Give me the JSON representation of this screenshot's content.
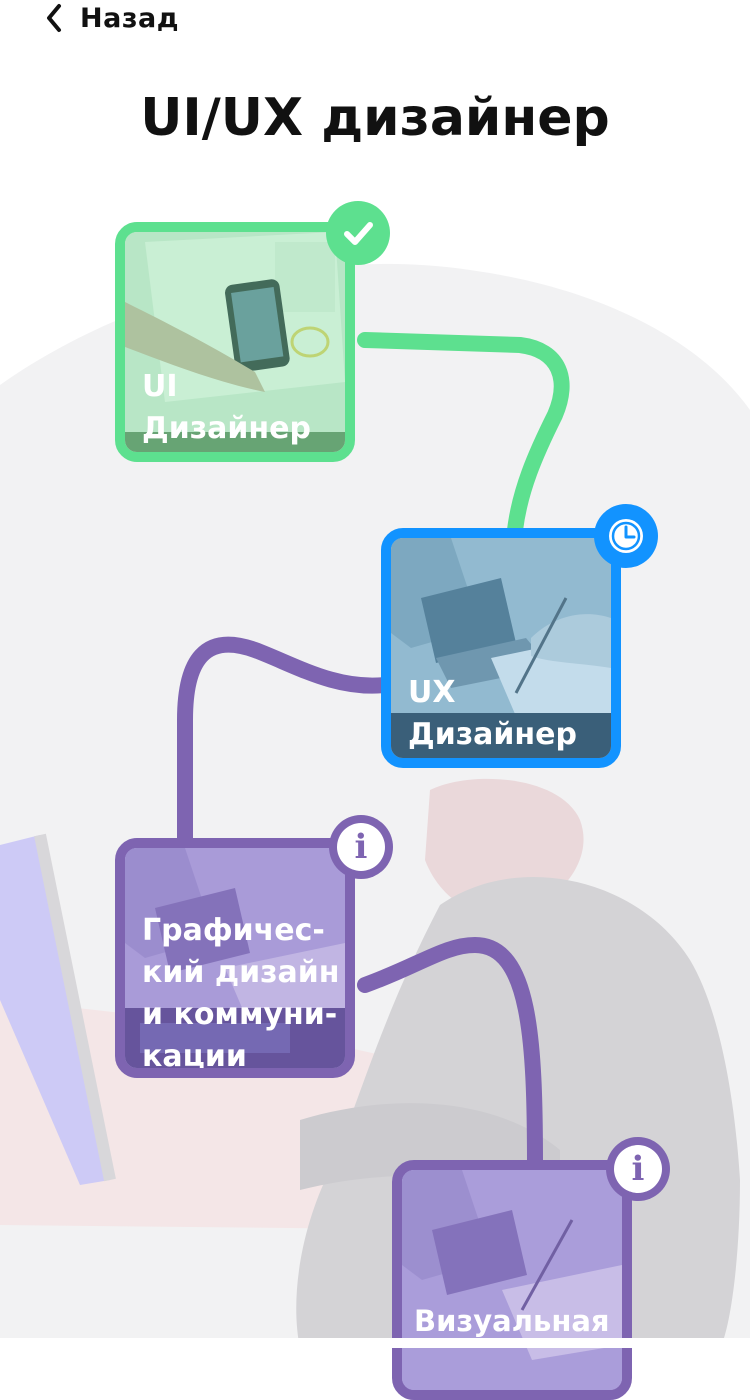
{
  "header": {
    "back_label": "Назад",
    "title": "UI/UX дизайнер"
  },
  "path": {
    "cards": [
      {
        "label": "UI Дизайнер",
        "status": "completed",
        "badge_icon": "checkmark-icon",
        "color": "#5DE08F"
      },
      {
        "label": "UX Дизайнер",
        "status": "in-progress",
        "badge_icon": "clock-icon",
        "color": "#1293FF"
      },
      {
        "label": "Графичес- кий дизайн и коммуни- кации",
        "status": "locked",
        "badge_icon": "info-icon",
        "color": "#7E64B1"
      },
      {
        "label": "Визуальная",
        "status": "locked",
        "badge_icon": "info-icon",
        "color": "#7E64B1"
      }
    ],
    "info_glyph": "i"
  },
  "colors": {
    "background_shape": "#F2F2F3",
    "illustration_gray": "#D4D3D6",
    "illustration_pink": "#EADADC",
    "illustration_lavender": "#CDCAF6"
  }
}
